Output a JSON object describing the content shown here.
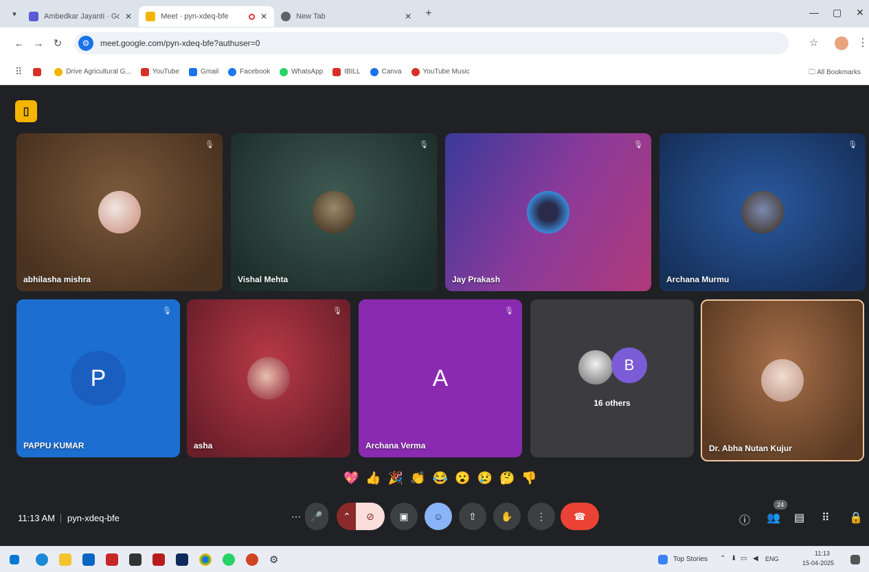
{
  "browser": {
    "tabs": [
      {
        "title": "Ambedkar Jayanti · Google",
        "favicon_color": "#5b5bd6",
        "active": false
      },
      {
        "title": "Meet · pyn-xdeq-bfe",
        "favicon_color": "#f4b400",
        "active": true
      },
      {
        "title": "New Tab",
        "favicon_color": "#5f6368",
        "active": false
      }
    ],
    "url": "meet.google.com/pyn-xdeq-bfe?authuser=0",
    "bookmarks": [
      {
        "label": "",
        "color": "#d93025"
      },
      {
        "label": "Drive Agricultural G...",
        "color": "#f4b400"
      },
      {
        "label": "YouTube",
        "color": "#d93025"
      },
      {
        "label": "Gmail",
        "color": "#1a73e8"
      },
      {
        "label": "Facebook",
        "color": "#1877f2"
      },
      {
        "label": "WhatsApp",
        "color": "#25d366"
      },
      {
        "label": "IBILL",
        "color": "#d93025"
      },
      {
        "label": "Canva",
        "color": "#1a73e8"
      },
      {
        "label": "YouTube Music",
        "color": "#d93025"
      }
    ],
    "all_bookmarks_label": "All Bookmarks"
  },
  "meet": {
    "logo_icon": "door-icon",
    "participants": [
      {
        "name": "abhilasha mishra",
        "bg": "#6b4a2a",
        "avatar_color": "#c98a7a"
      },
      {
        "name": "Vishal Mehta",
        "bg": "#2f4a42",
        "avatar_color": "#7a5a3a"
      },
      {
        "name": "Jay Prakash",
        "bg": "#8a3a9a",
        "avatar_color": "#3a5aa8"
      },
      {
        "name": "Archana Murmu",
        "bg": "#1f4a8a",
        "avatar_color": "#5a3a2a"
      },
      {
        "name": "PAPPU KUMAR",
        "letter": "P",
        "bg": "#1c6fd0",
        "letter_bg": "#1a5fc0"
      },
      {
        "name": "asha",
        "bg": "#8a2a36",
        "avatar_color": "#b03a4a"
      },
      {
        "name": "Archana Verma",
        "letter": "A",
        "bg": "#8a2ab0",
        "letter_bg": "#8a2ab0"
      },
      {
        "name": "16 others",
        "letter": "B",
        "bg": "#3c3c40",
        "letter_bg": "#7b5cd6"
      },
      {
        "name": "Dr. Abha Nutan Kujur",
        "bg": "#8a5a3a",
        "avatar_color": "#e8c6b6"
      }
    ],
    "reactions": [
      "💖",
      "👍",
      "🎉",
      "👏",
      "😂",
      "😮",
      "😢",
      "🤔",
      "👎"
    ],
    "time": "11:13 AM",
    "meeting_code": "pyn-xdeq-bfe",
    "participant_count": "24",
    "end_call_color": "#ea4335"
  },
  "taskbar": {
    "news_label": "Top Stories",
    "lang": "ENG",
    "time": "11:13",
    "date": "15-04-2025"
  }
}
